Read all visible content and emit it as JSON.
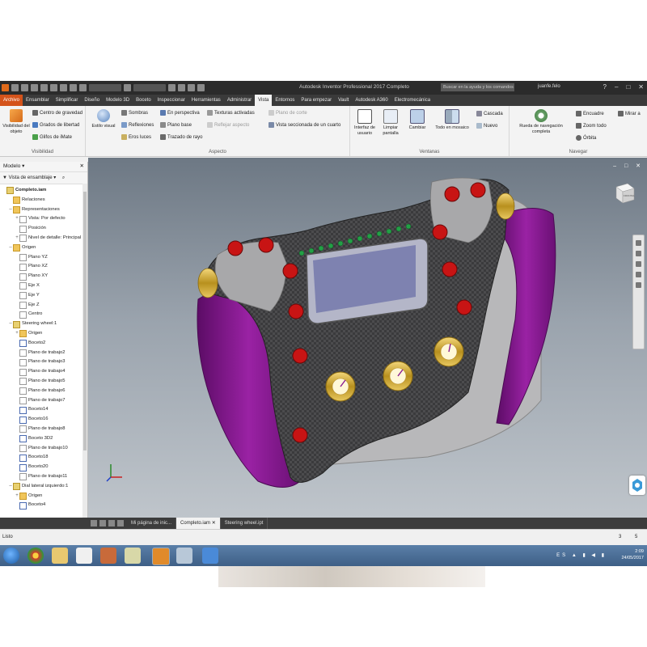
{
  "titlebar": {
    "title": "Autodesk Inventor Professional 2017   Completo",
    "search_placeholder": "Buscar en la ayuda y los comandos",
    "user": "juanfe.felo",
    "help": "?",
    "minimize": "–",
    "maximize": "□",
    "close": "✕"
  },
  "menu_tabs": [
    "Archivo",
    "Ensamblar",
    "Simplificar",
    "Diseño",
    "Modelo 3D",
    "Boceto",
    "Inspeccionar",
    "Herramientas",
    "Administrar",
    "Vista",
    "Entornos",
    "Para empezar",
    "Vault",
    "Autodesk A360",
    "Electromecánica"
  ],
  "active_tab": "Vista",
  "ribbon": {
    "visibilidad": {
      "label": "Visibilidad",
      "big": "Visibilidad del objeto",
      "items": [
        "Centro de gravedad",
        "Grados de libertad",
        "Glifos de iMate"
      ]
    },
    "aspecto": {
      "label": "Aspecto",
      "estilo": "Estilo visual",
      "col1": [
        "Sombras",
        "Reflexiones",
        "Eros luces"
      ],
      "col2": [
        "En perspectiva",
        "Plano base",
        "Trazado de rayo"
      ],
      "col3": [
        "Texturas activadas",
        "Reflejar aspecto"
      ],
      "col4": [
        "Plano de corte",
        "Vista seccionada de un cuarto"
      ]
    },
    "ventanas": {
      "label": "Ventanas",
      "items": [
        "Interfaz de usuario",
        "Limpiar pantalla",
        "Cambiar",
        "Todo en mosaico",
        "Cascada",
        "Nuevo"
      ]
    },
    "navegar": {
      "label": "Navegar",
      "rueda": "Rueda de navegación completa",
      "items": [
        "Encuadre",
        "Zoom todo",
        "Órbita",
        "Mirar a"
      ]
    }
  },
  "browser": {
    "title": "Modelo",
    "close": "✕",
    "help": "?",
    "toolbar": "Vista de ensamblaje",
    "nodes": [
      {
        "text": "Completo.iam",
        "indent": 0,
        "icon": "asm",
        "exp": ""
      },
      {
        "text": "Relaciones",
        "indent": 1,
        "icon": "folder",
        "exp": ""
      },
      {
        "text": "Representaciones",
        "indent": 1,
        "icon": "folder",
        "exp": "–"
      },
      {
        "text": "Vista: Por defecto",
        "indent": 2,
        "icon": "plane",
        "exp": "+"
      },
      {
        "text": "Posición",
        "indent": 2,
        "icon": "plane",
        "exp": ""
      },
      {
        "text": "Nivel de detalle: Principal",
        "indent": 2,
        "icon": "plane",
        "exp": "+"
      },
      {
        "text": "Origen",
        "indent": 1,
        "icon": "folder",
        "exp": "–"
      },
      {
        "text": "Plano YZ",
        "indent": 2,
        "icon": "plane",
        "exp": ""
      },
      {
        "text": "Plano XZ",
        "indent": 2,
        "icon": "plane",
        "exp": ""
      },
      {
        "text": "Plano XY",
        "indent": 2,
        "icon": "plane",
        "exp": ""
      },
      {
        "text": "Eje X",
        "indent": 2,
        "icon": "plane",
        "exp": ""
      },
      {
        "text": "Eje Y",
        "indent": 2,
        "icon": "plane",
        "exp": ""
      },
      {
        "text": "Eje Z",
        "indent": 2,
        "icon": "plane",
        "exp": ""
      },
      {
        "text": "Centro",
        "indent": 2,
        "icon": "plane",
        "exp": ""
      },
      {
        "text": "Steering wheel:1",
        "indent": 1,
        "icon": "asm",
        "exp": "–"
      },
      {
        "text": "Origen",
        "indent": 2,
        "icon": "folder",
        "exp": "+"
      },
      {
        "text": "Boceto2",
        "indent": 2,
        "icon": "sketch",
        "exp": ""
      },
      {
        "text": "Plano de trabajo2",
        "indent": 2,
        "icon": "plane",
        "exp": ""
      },
      {
        "text": "Plano de trabajo3",
        "indent": 2,
        "icon": "plane",
        "exp": ""
      },
      {
        "text": "Plano de trabajo4",
        "indent": 2,
        "icon": "plane",
        "exp": ""
      },
      {
        "text": "Plano de trabajo5",
        "indent": 2,
        "icon": "plane",
        "exp": ""
      },
      {
        "text": "Plano de trabajo6",
        "indent": 2,
        "icon": "plane",
        "exp": ""
      },
      {
        "text": "Plano de trabajo7",
        "indent": 2,
        "icon": "plane",
        "exp": ""
      },
      {
        "text": "Boceto14",
        "indent": 2,
        "icon": "sketch",
        "exp": ""
      },
      {
        "text": "Boceto16",
        "indent": 2,
        "icon": "sketch",
        "exp": ""
      },
      {
        "text": "Plano de trabajo8",
        "indent": 2,
        "icon": "plane",
        "exp": ""
      },
      {
        "text": "Boceto 3D2",
        "indent": 2,
        "icon": "sketch",
        "exp": ""
      },
      {
        "text": "Plano de trabajo10",
        "indent": 2,
        "icon": "plane",
        "exp": ""
      },
      {
        "text": "Boceto18",
        "indent": 2,
        "icon": "sketch",
        "exp": ""
      },
      {
        "text": "Boceto20",
        "indent": 2,
        "icon": "sketch",
        "exp": ""
      },
      {
        "text": "Plano de trabajo11",
        "indent": 2,
        "icon": "plane",
        "exp": ""
      },
      {
        "text": "Dial lateral izquierdo:1",
        "indent": 1,
        "icon": "asm",
        "exp": "–"
      },
      {
        "text": "Origen",
        "indent": 2,
        "icon": "folder",
        "exp": "+"
      },
      {
        "text": "Boceto4",
        "indent": 2,
        "icon": "sketch",
        "exp": ""
      }
    ]
  },
  "viewcube": {
    "label": "FRONTAL"
  },
  "doc_tabs": [
    {
      "label": "Mi página de inic...",
      "active": false
    },
    {
      "label": "Completo.iam",
      "active": true,
      "close": "✕"
    },
    {
      "label": "Steering wheel.ipt",
      "active": false
    }
  ],
  "status": {
    "text": "Listo",
    "count1": "3",
    "count2": "5"
  },
  "taskbar": {
    "lang": "ES",
    "time": "2:09",
    "date": "24/05/2017"
  },
  "colors": {
    "file_tab": "#d4531b",
    "grip": "#8a1a90",
    "button": "#c81414",
    "led": "#22a040",
    "carbon": "#3c3c3e",
    "gold": "#c9a02a"
  }
}
